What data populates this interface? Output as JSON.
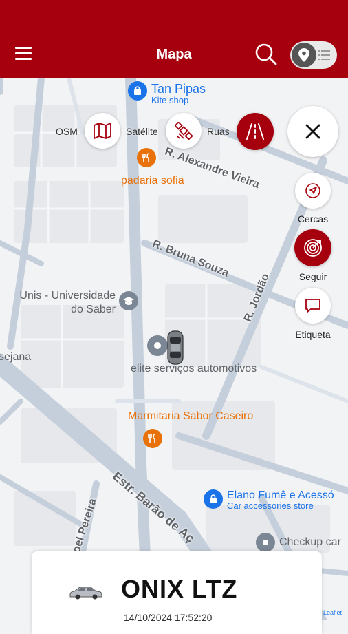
{
  "header": {
    "title": "Mapa",
    "bg_color": "#a6000e"
  },
  "toolbar": {
    "menu_icon": "hamburger-menu-icon",
    "search_icon": "search-icon",
    "toggle_icons": [
      "location-pin-icon",
      "list-icon"
    ]
  },
  "map_layers": [
    {
      "label": "OSM",
      "icon": "map-icon",
      "active": false
    },
    {
      "label": "Satélite",
      "icon": "satellite-icon",
      "active": false
    },
    {
      "label": "Ruas",
      "icon": "road-icon",
      "active": true
    }
  ],
  "map_tools": [
    {
      "label": "Cercas",
      "icon": "navigation-arrow-icon",
      "active": false
    },
    {
      "label": "Seguir",
      "icon": "target-icon",
      "active": true
    },
    {
      "label": "Etiqueta",
      "icon": "speech-bubble-icon",
      "active": false
    }
  ],
  "close_icon": "close-icon",
  "map": {
    "pois": {
      "tan_pipas": {
        "name": "Tan Pipas",
        "sub": "Kite shop"
      },
      "padaria": {
        "name": "padaria sofia"
      },
      "unis": {
        "name_line1": "Unis - Universidade",
        "name_line2": "do Saber"
      },
      "elite": {
        "name": "elite serviços automotivos"
      },
      "marmitaria": {
        "name": "Marmitaria Sabor Caseiro"
      },
      "elano": {
        "name": "Elano Fumê e Acessó",
        "sub": "Car accessories store"
      },
      "checkup": {
        "name": "Checkup car"
      },
      "sejana": {
        "name": "sejana"
      }
    },
    "roads": {
      "alexandre": "R. Alexandre Vieira",
      "bruna": "R. Bruna Souza",
      "jordao": "R. Jordão",
      "barao": "Estr. Barão de Aç",
      "manoel": "noel Pereira"
    },
    "attribution": "Leaflet"
  },
  "vehicle_card": {
    "vehicle_name": "ONIX LTZ",
    "timestamp": "14/10/2024 17:52:20",
    "car_icon": "car-icon"
  },
  "colors": {
    "accent": "#a6000e",
    "poi_blue": "#1a73e8",
    "poi_orange": "#e8710a"
  }
}
